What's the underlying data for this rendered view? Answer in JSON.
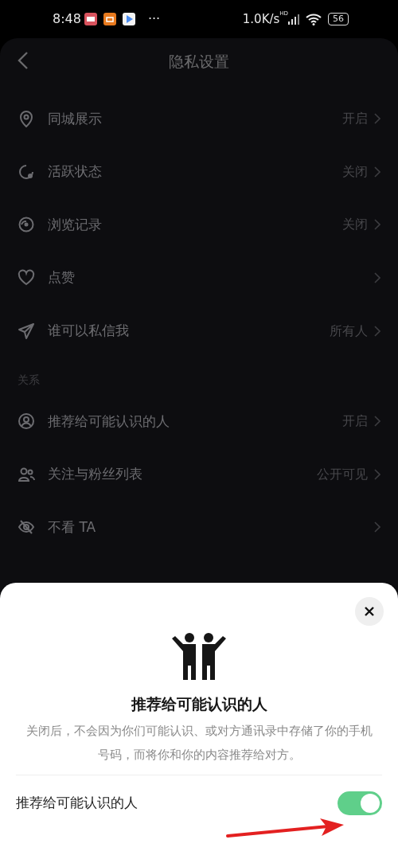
{
  "status_bar": {
    "time": "8:48",
    "more": "···",
    "speed": "1.0K/s",
    "network": "HD",
    "battery": "56"
  },
  "header": {
    "title": "隐私设置"
  },
  "groups": [
    {
      "items": [
        {
          "label": "同城展示",
          "value": "开启"
        },
        {
          "label": "活跃状态",
          "value": "关闭"
        },
        {
          "label": "浏览记录",
          "value": "关闭"
        },
        {
          "label": "点赞"
        },
        {
          "label": "谁可以私信我",
          "value": "所有人"
        }
      ]
    },
    {
      "label": "关系",
      "items": [
        {
          "label": "推荐给可能认识的人",
          "value": "开启"
        },
        {
          "label": "关注与粉丝列表",
          "value": "公开可见"
        },
        {
          "label": "不看 TA"
        }
      ]
    }
  ],
  "sheet": {
    "title": "推荐给可能认识的人",
    "description": "关闭后，不会因为你们可能认识、或对方通讯录中存储了你的手机号码，而将你和你的内容推荐给对方。",
    "toggle": {
      "label": "推荐给可能认识的人",
      "on": true
    }
  }
}
